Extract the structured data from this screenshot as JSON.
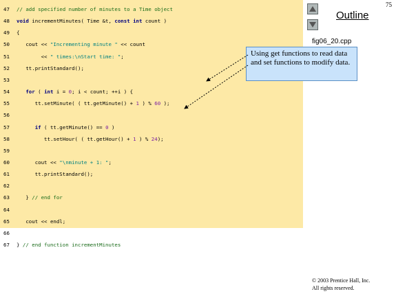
{
  "page_number": "75",
  "nav": {
    "outline_label": "Outline",
    "filename": "fig06_20.cpp"
  },
  "callout": {
    "text": "Using get functions to read data and set functions to modify data."
  },
  "copyright": {
    "line1": "© 2003 Prentice Hall, Inc.",
    "line2": "All rights reserved."
  },
  "code_lines": [
    {
      "num": "47",
      "parts": [
        [
          "c",
          "// add specified number of minutes to a Time object"
        ]
      ]
    },
    {
      "num": "48",
      "parts": [
        [
          "k",
          "void"
        ],
        [
          "p",
          " incrementMinutes( Time &t, "
        ],
        [
          "k",
          "const int"
        ],
        [
          "p",
          " count )"
        ]
      ]
    },
    {
      "num": "49",
      "parts": [
        [
          "p",
          "{"
        ]
      ]
    },
    {
      "num": "50",
      "parts": [
        [
          "p",
          "   cout << "
        ],
        [
          "s",
          "\"Incrementing minute \""
        ],
        [
          "p",
          " << count"
        ]
      ]
    },
    {
      "num": "51",
      "parts": [
        [
          "p",
          "        << "
        ],
        [
          "s",
          "\" times:\\nStart time: \""
        ],
        [
          "p",
          ";"
        ]
      ]
    },
    {
      "num": "52",
      "parts": [
        [
          "p",
          "   tt.printStandard();"
        ]
      ]
    },
    {
      "num": "53",
      "parts": [
        [
          "p",
          ""
        ]
      ]
    },
    {
      "num": "54",
      "parts": [
        [
          "k",
          "   for"
        ],
        [
          "p",
          " ( "
        ],
        [
          "k",
          "int"
        ],
        [
          "p",
          " i = "
        ],
        [
          "n",
          "0"
        ],
        [
          "p",
          "; i < count; ++i ) {"
        ]
      ]
    },
    {
      "num": "55",
      "parts": [
        [
          "p",
          "      tt.setMinute( ( tt.getMinute() + "
        ],
        [
          "n",
          "1"
        ],
        [
          "p",
          " ) % "
        ],
        [
          "n",
          "60"
        ],
        [
          "p",
          " );"
        ]
      ]
    },
    {
      "num": "56",
      "parts": [
        [
          "p",
          ""
        ]
      ]
    },
    {
      "num": "57",
      "parts": [
        [
          "k",
          "      if"
        ],
        [
          "p",
          " ( tt.getMinute() == "
        ],
        [
          "n",
          "0"
        ],
        [
          "p",
          " )"
        ]
      ]
    },
    {
      "num": "58",
      "parts": [
        [
          "p",
          "         tt.setHour( ( tt.getHour() + "
        ],
        [
          "n",
          "1"
        ],
        [
          "p",
          " ) % "
        ],
        [
          "n",
          "24"
        ],
        [
          "p",
          ");"
        ]
      ]
    },
    {
      "num": "59",
      "parts": [
        [
          "p",
          ""
        ]
      ]
    },
    {
      "num": "60",
      "parts": [
        [
          "p",
          "      cout << "
        ],
        [
          "s",
          "\"\\nminute + 1: \""
        ],
        [
          "p",
          ";"
        ]
      ]
    },
    {
      "num": "61",
      "parts": [
        [
          "p",
          "      tt.printStandard();"
        ]
      ]
    },
    {
      "num": "62",
      "parts": [
        [
          "p",
          ""
        ]
      ]
    },
    {
      "num": "63",
      "parts": [
        [
          "p",
          "   } "
        ],
        [
          "c",
          "// end for"
        ]
      ]
    },
    {
      "num": "64",
      "parts": [
        [
          "p",
          ""
        ]
      ]
    },
    {
      "num": "65",
      "parts": [
        [
          "p",
          "   cout << endl;"
        ]
      ]
    },
    {
      "num": "66",
      "parts": [
        [
          "p",
          ""
        ]
      ]
    },
    {
      "num": "67",
      "parts": [
        [
          "p",
          "} "
        ],
        [
          "c",
          "// end function incrementMinutes"
        ]
      ]
    }
  ],
  "colors": {
    "code_background": "#fde9a6",
    "callout_background": "#c9e3fb"
  }
}
